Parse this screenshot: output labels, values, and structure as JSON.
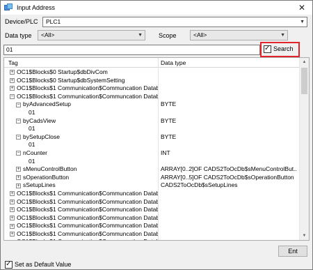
{
  "window": {
    "title": "Input Address",
    "close_glyph": "✕"
  },
  "device": {
    "label": "Device/PLC",
    "value": "PLC1"
  },
  "datatype": {
    "label": "Data type",
    "value": "<All>"
  },
  "scope": {
    "label": "Scope",
    "value": "<All>"
  },
  "search": {
    "value": "01",
    "label": "Search",
    "checked": true
  },
  "grid": {
    "columns": [
      "Tag",
      "Data type"
    ],
    "rows": [
      {
        "tag": "OC1$Blocks$0 Startup$dbDivCom",
        "type": "",
        "level": 0,
        "exp": "+"
      },
      {
        "tag": "OC1$Blocks$0 Startup$dbSystemSetting",
        "type": "",
        "level": 0,
        "exp": "+"
      },
      {
        "tag": "OC1$Blocks$1 Communication$Communcation Databloc...",
        "type": "",
        "level": 0,
        "exp": "+"
      },
      {
        "tag": "OC1$Blocks$1 Communication$Communcation Databloc...",
        "type": "",
        "level": 0,
        "exp": "−"
      },
      {
        "tag": "byAdvancedSetup",
        "type": "BYTE",
        "level": 1,
        "exp": "−"
      },
      {
        "tag": "01",
        "type": "",
        "level": 2,
        "exp": ""
      },
      {
        "tag": "byCadsView",
        "type": "BYTE",
        "level": 1,
        "exp": "−"
      },
      {
        "tag": "01",
        "type": "",
        "level": 2,
        "exp": ""
      },
      {
        "tag": "bySetupClose",
        "type": "BYTE",
        "level": 1,
        "exp": "−"
      },
      {
        "tag": "01",
        "type": "",
        "level": 2,
        "exp": ""
      },
      {
        "tag": "nCounter",
        "type": "INT",
        "level": 1,
        "exp": "−"
      },
      {
        "tag": "01",
        "type": "",
        "level": 2,
        "exp": ""
      },
      {
        "tag": "sMenuControlButton",
        "type": "ARRAY[0..2]OF CADS2ToOcDb$sMenuControlBut...",
        "level": 1,
        "exp": "+"
      },
      {
        "tag": "sOperationButton",
        "type": "ARRAY[0..5]OF CADS2ToOcDb$sOperationButton",
        "level": 1,
        "exp": "+"
      },
      {
        "tag": "sSetupLines",
        "type": "CADS2ToOcDb$sSetupLines",
        "level": 1,
        "exp": "+"
      },
      {
        "tag": "OC1$Blocks$1 Communication$Communcation Databloc...",
        "type": "",
        "level": 0,
        "exp": "+"
      },
      {
        "tag": "OC1$Blocks$1 Communication$Communcation Databloc...",
        "type": "",
        "level": 0,
        "exp": "+"
      },
      {
        "tag": "OC1$Blocks$1 Communication$Communcation Databloc...",
        "type": "",
        "level": 0,
        "exp": "+"
      },
      {
        "tag": "OC1$Blocks$1 Communication$Communcation Databloc...",
        "type": "",
        "level": 0,
        "exp": "+"
      },
      {
        "tag": "OC1$Blocks$1 Communication$Communcation Databloc...",
        "type": "",
        "level": 0,
        "exp": "+"
      },
      {
        "tag": "OC1$Blocks$1 Communication$Communcation Databloc...",
        "type": "",
        "level": 0,
        "exp": "+"
      },
      {
        "tag": "OC1$Blocks$1 Communication$Communcation Databloc...",
        "type": "",
        "level": 0,
        "exp": "+"
      }
    ]
  },
  "footer": {
    "ent_label": "Ent",
    "default_label": "Set as Default Value",
    "default_checked": true
  }
}
